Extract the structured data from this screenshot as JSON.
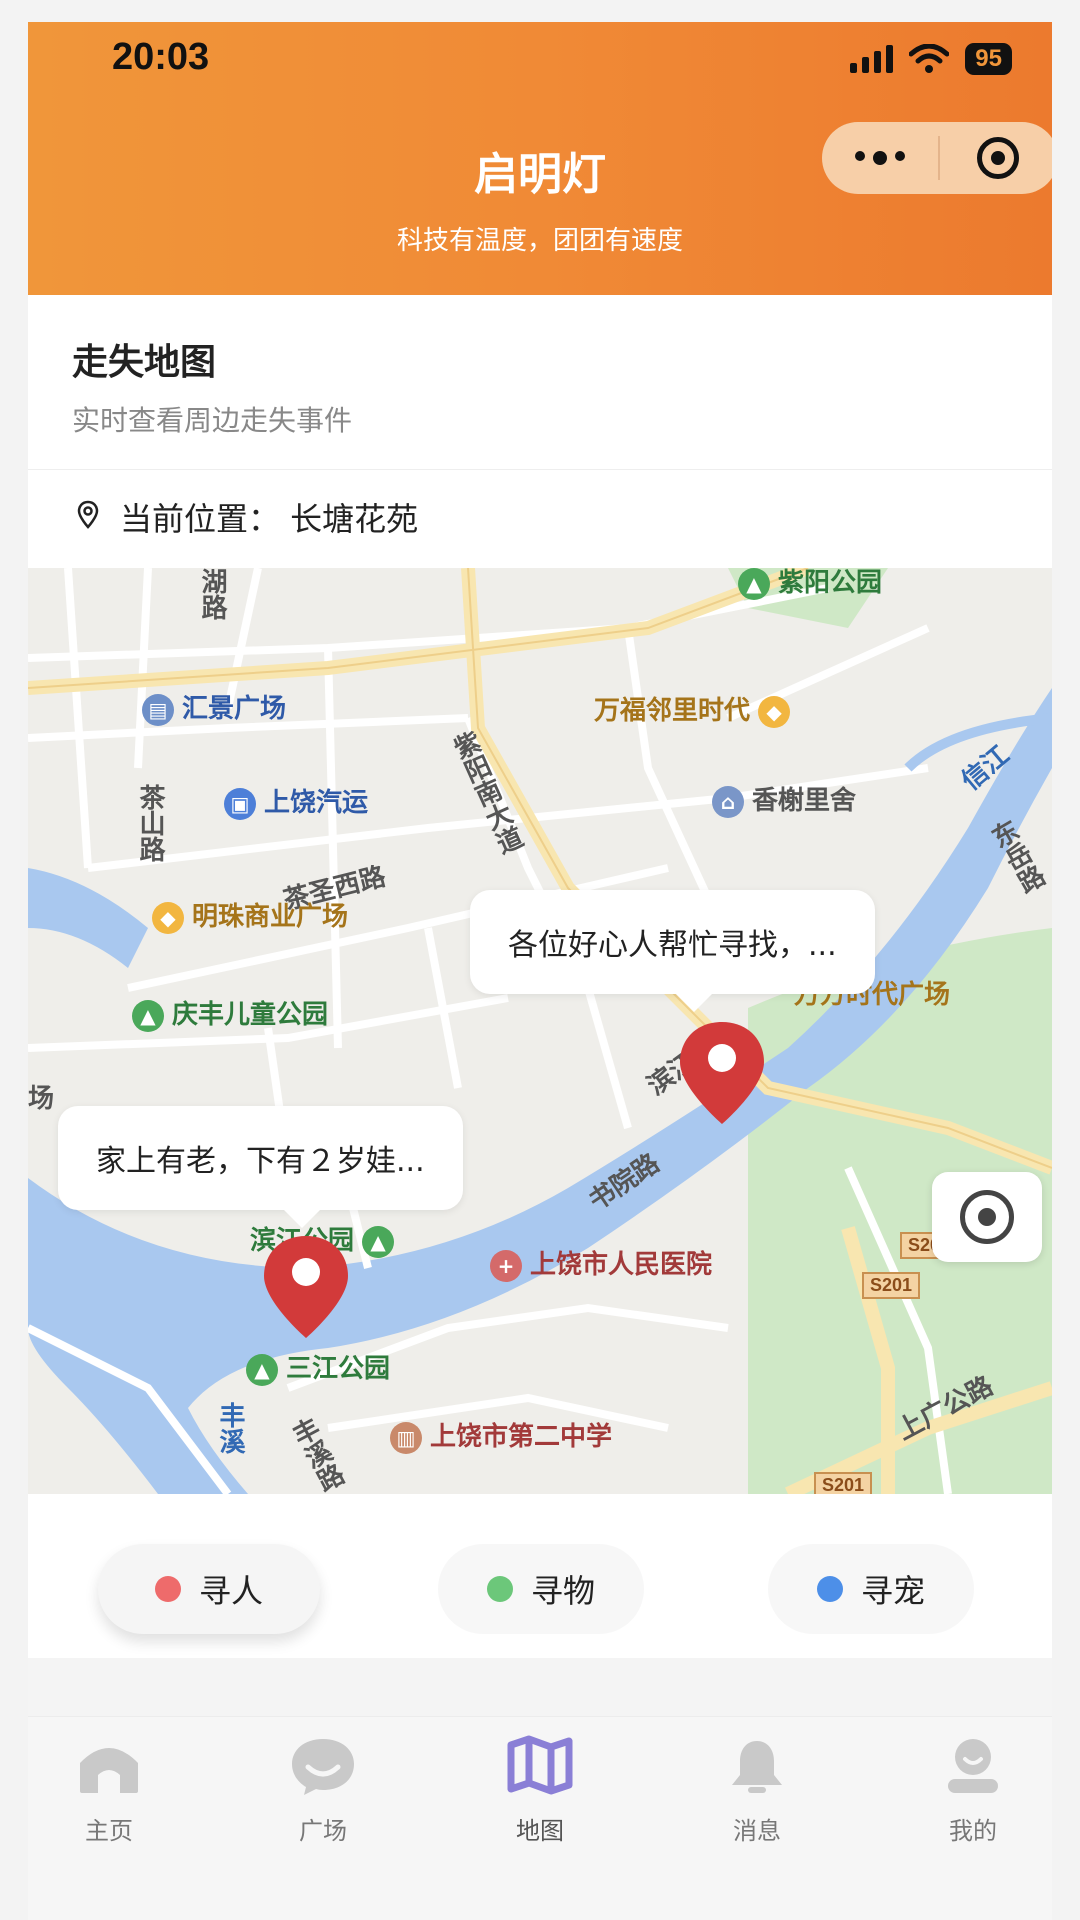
{
  "status_bar": {
    "time": "20:03",
    "battery": "95"
  },
  "header": {
    "title": "启明灯",
    "subtitle": "科技有温度，团团有速度"
  },
  "section": {
    "title": "走失地图",
    "description": "实时查看周边走失事件"
  },
  "location": {
    "text": "当前位置： 长塘花苑"
  },
  "map": {
    "labels": {
      "hu_lu": "湖路",
      "huijing": "汇景广场",
      "wanfu": "万福邻里时代",
      "ziyang_park": "紫阳公园",
      "ziyang_avenue": "紫阳南大道",
      "xinjiang": "信江",
      "chashan": "茶山路",
      "shangrao_bus": "上饶汽运",
      "xiangxie": "香榭里舍",
      "dongyue": "东岳路",
      "chasheng": "茶圣西路",
      "mingzhu": "明珠商业广场",
      "wanfang": "万方时代广场",
      "qingfeng": "庆丰儿童公园",
      "changye": "场",
      "binjiang_road": "滨江路",
      "shuyuan": "书院路",
      "binjiang_park": "滨江公园",
      "hospital": "上饶市人民医院",
      "sanjiang": "三江公园",
      "fengxi": "丰溪",
      "fengxi_road": "丰溪路",
      "school": "上饶市第二中学",
      "shangguang": "上广公路",
      "s201_a": "S201",
      "s201_b": "S201",
      "s201_c": "S201"
    },
    "bubbles": [
      {
        "text": "各位好心人帮忙寻找，..."
      },
      {
        "text": "家上有老，下有２岁娃..."
      }
    ],
    "colors": {
      "marker": "#d23a3a",
      "water": "#a9c8ef",
      "park": "#cfe8c6",
      "road": "#ffffff",
      "main_road": "#f8e6b0"
    }
  },
  "filters": [
    {
      "label": "寻人",
      "color": "#ee6b6b"
    },
    {
      "label": "寻物",
      "color": "#6cc77a"
    },
    {
      "label": "寻宠",
      "color": "#4d8fe8"
    }
  ],
  "nav": [
    {
      "label": "主页",
      "icon": "home-icon"
    },
    {
      "label": "广场",
      "icon": "chat-icon"
    },
    {
      "label": "地图",
      "icon": "map-icon"
    },
    {
      "label": "消息",
      "icon": "bell-icon"
    },
    {
      "label": "我的",
      "icon": "profile-icon"
    }
  ]
}
